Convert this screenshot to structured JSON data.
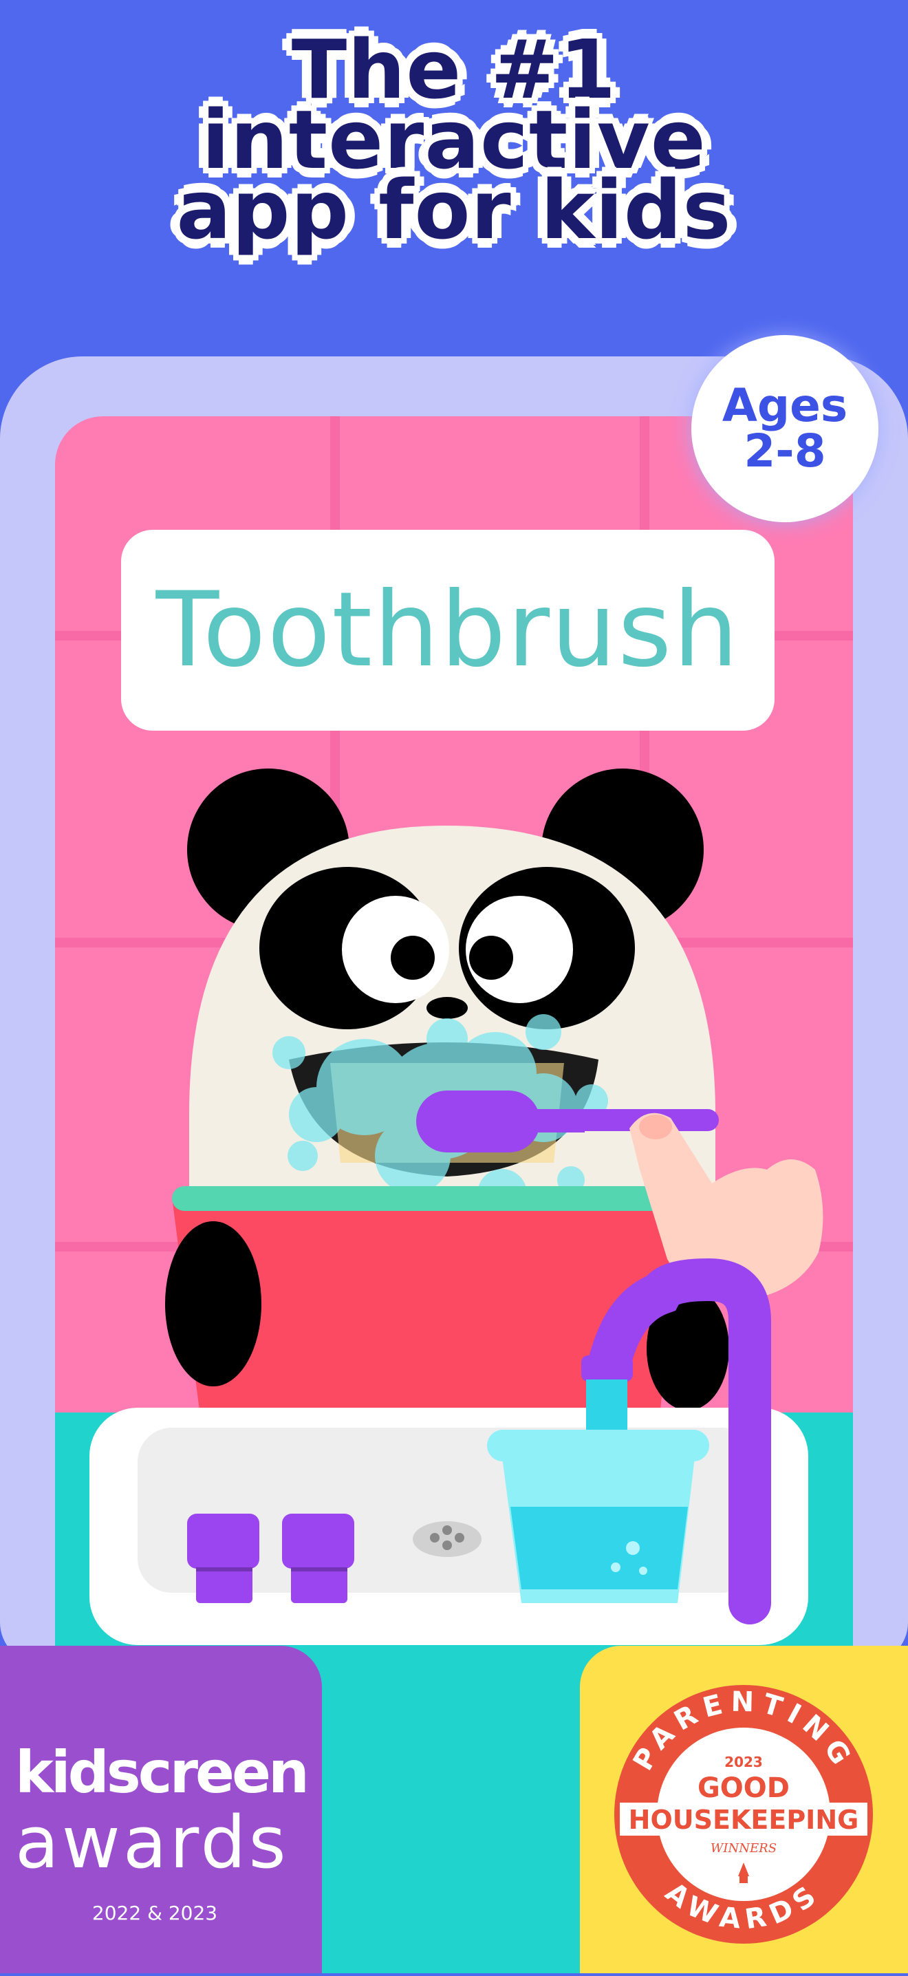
{
  "headline": {
    "line1": "The #1",
    "line2": "interactive",
    "line3": "app for kids"
  },
  "ages_badge": {
    "line1": "Ages",
    "line2": "2-8"
  },
  "game": {
    "word": "Toothbrush"
  },
  "awards": {
    "kidscreen": {
      "line1": "kidscreen",
      "line2": "awards",
      "years": "2022 & 2023"
    },
    "good_housekeeping": {
      "top_arc": "PARENTING",
      "year": "2023",
      "line1": "GOOD",
      "line2": "HOUSEKEEPING",
      "winners": "WINNERS",
      "bottom_arc": "AWARDS"
    }
  },
  "colors": {
    "background": "#4f68ee",
    "headline": "#1c1c6e",
    "tile": "#ff7cb3",
    "counter": "#21d3cd",
    "kidscreen_bg": "#9a4fcf",
    "gh_bg": "#fde04a",
    "gh_red": "#e9513a",
    "toothbrush": "#9b45f0"
  },
  "icons": [
    "panda-character",
    "toothbrush-icon",
    "hand-pointer-icon",
    "faucet-icon",
    "water-cup-icon",
    "soap-dish-icon"
  ]
}
